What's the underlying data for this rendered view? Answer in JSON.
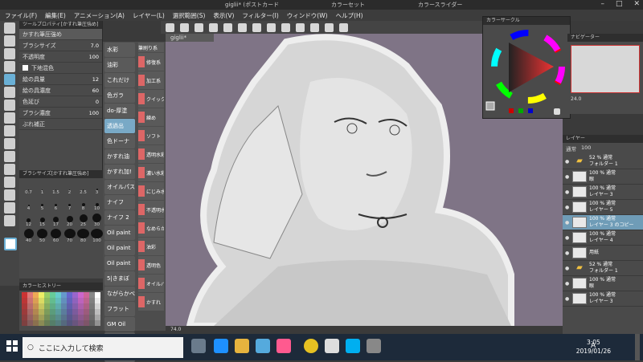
{
  "window": {
    "title": "giglii* (ポストカード",
    "secondary_title_1": "カラーセット",
    "secondary_title_2": "カラースライダー"
  },
  "menu": [
    "ファイル(F)",
    "編集(E)",
    "アニメーション(A)",
    "レイヤー(L)",
    "選択範囲(S)",
    "表示(V)",
    "フィルター(I)",
    "ウィンドウ(W)",
    "ヘルプ(H)"
  ],
  "subtool_panel": {
    "header": "ツールプロパティ[かすれ筆圧強め]",
    "brush_name": "かすれ筆圧強め",
    "props": [
      {
        "label": "ブラシサイズ",
        "value": "7.0"
      },
      {
        "label": "不透明度",
        "value": "100"
      },
      {
        "label": "下地混色",
        "value": ""
      },
      {
        "label": "絵の具量",
        "value": "12"
      },
      {
        "label": "絵の具濃度",
        "value": "60"
      },
      {
        "label": "色延び",
        "value": "0"
      },
      {
        "label": "ブラシ濃度",
        "value": "100"
      },
      {
        "label": "ぶれ補正",
        "value": ""
      }
    ]
  },
  "brush_sizes": {
    "header": "ブラシサイズ[かすれ筆圧強め]",
    "sizes": [
      "0.7",
      "1",
      "1.5",
      "2",
      "2.5",
      "3",
      "4",
      "5",
      "6",
      "7",
      "8",
      "10",
      "12",
      "15",
      "17",
      "20",
      "25",
      "30",
      "40",
      "50",
      "60",
      "70",
      "80",
      "100"
    ]
  },
  "palette_header": "カラーヒストリー",
  "brush_list_1": [
    "水彩",
    "油彩",
    "これだけ",
    "色ガラ",
    "do-厚塗",
    "透過出",
    "色ドーナ",
    "かすれ油",
    "かすれ加!",
    "オイルパス",
    "ナイフ",
    "ナイフ 2",
    "Oil paint",
    "Oil paint",
    "Oil paint",
    "5|きまぼ",
    "ながらかべ",
    "フラット",
    "GM Oil",
    "GM Oil",
    "Fix Pain"
  ],
  "brush_list_2_header": "筆刷り系",
  "brush_list_2": [
    "修復系",
    "加工系",
    "クイック",
    "練め",
    "ソフト",
    "透明水彩",
    "濃い水彩",
    "にじみ水彩",
    "不透明水彩",
    "なめらか",
    "油彩",
    "透明色",
    "オイルパステル",
    "かすれ"
  ],
  "canvas": {
    "tab": "giglii*",
    "zoom": "74.0"
  },
  "color_wheel": {
    "header": "カラーサークル"
  },
  "navigator": {
    "header": "ナビゲーター",
    "zoom": "24.0"
  },
  "layers": {
    "header": "レイヤー",
    "blend": "通常",
    "opacity": "100",
    "items": [
      {
        "name": "52 % 通常",
        "sub": "フォルダー 1",
        "type": "folder"
      },
      {
        "name": "100 % 通常",
        "sub": "眼",
        "type": "layer"
      },
      {
        "name": "100 % 通常",
        "sub": "レイヤー 3",
        "type": "layer"
      },
      {
        "name": "100 % 通常",
        "sub": "レイヤー 5",
        "type": "layer"
      },
      {
        "name": "100 % 通常",
        "sub": "レイヤー 3 のコピー",
        "type": "layer",
        "selected": true
      },
      {
        "name": "100 % 通常",
        "sub": "レイヤー 4",
        "type": "layer"
      },
      {
        "name": "",
        "sub": "用紙",
        "type": "paper"
      },
      {
        "name": "52 % 通常",
        "sub": "フォルダー 1",
        "type": "folder"
      },
      {
        "name": "100 % 通常",
        "sub": "眼",
        "type": "layer"
      },
      {
        "name": "100 % 通常",
        "sub": "レイヤー 3",
        "type": "layer"
      }
    ]
  },
  "taskbar": {
    "search_placeholder": "ここに入力して検索",
    "time": "3:05",
    "date": "2019/01/26",
    "ime": "A"
  }
}
